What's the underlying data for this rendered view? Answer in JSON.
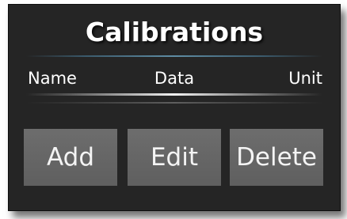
{
  "dialog": {
    "title": "Calibrations",
    "columns": {
      "name": "Name",
      "data": "Data",
      "unit": "Unit"
    },
    "buttons": {
      "add": "Add",
      "edit": "Edit",
      "delete": "Delete"
    }
  },
  "colors": {
    "panel_background": "#252525",
    "button_background": "#676767",
    "accent_divider": "#5f8da4",
    "text": "#ffffff"
  }
}
